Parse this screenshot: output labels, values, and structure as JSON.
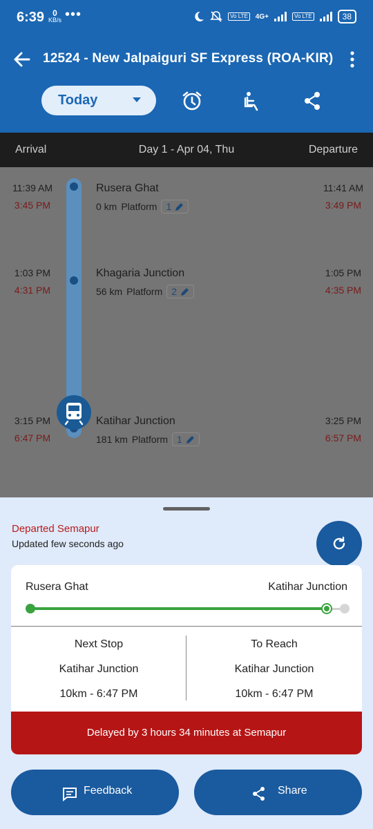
{
  "status_bar": {
    "time": "6:39",
    "net_speed": "0",
    "net_unit": "KB/s",
    "dots": "•••",
    "volte1": "Vo LTE",
    "network": "4G+",
    "volte2": "Vo LTE",
    "battery": "38"
  },
  "app_bar": {
    "title": "12524 - New Jalpaiguri SF Express (ROA-KIR)",
    "day_selector": "Today"
  },
  "day_header": {
    "arrival": "Arrival",
    "day": "Day 1 - Apr 04, Thu",
    "departure": "Departure"
  },
  "stations": [
    {
      "name": "Rusera Ghat",
      "arr_sched": "11:39 AM",
      "arr_actual": "3:45 PM",
      "dep_sched": "11:41 AM",
      "dep_actual": "3:49 PM",
      "distance": "0 km",
      "platform_label": "Platform",
      "platform": "1"
    },
    {
      "name": "Khagaria Junction",
      "arr_sched": "1:03 PM",
      "arr_actual": "4:31 PM",
      "dep_sched": "1:05 PM",
      "dep_actual": "4:35 PM",
      "distance": "56 km",
      "platform_label": "Platform",
      "platform": "2"
    },
    {
      "name": "Katihar Junction",
      "arr_sched": "3:15 PM",
      "arr_actual": "6:47 PM",
      "dep_sched": "3:25 PM",
      "dep_actual": "6:57 PM",
      "distance": "181 km",
      "platform_label": "Platform",
      "platform": "1"
    }
  ],
  "live_status": {
    "departed": "Departed Semapur",
    "updated": "Updated few seconds ago",
    "from_station": "Rusera Ghat",
    "to_station": "Katihar Junction",
    "progress": 0.95,
    "next_stop_label": "Next Stop",
    "next_stop_station": "Katihar Junction",
    "next_stop_eta": "10km - 6:47 PM",
    "to_reach_label": "To Reach",
    "to_reach_station": "Katihar Junction",
    "to_reach_eta": "10km - 6:47 PM",
    "delay_message": "Delayed by 3 hours 34 minutes at Semapur"
  },
  "actions": {
    "feedback": "Feedback",
    "share": "Share"
  },
  "colors": {
    "primary": "#1b67b3",
    "progress": "#3aa33f",
    "delay": "#b61515",
    "late_time": "#7a1a1a"
  }
}
